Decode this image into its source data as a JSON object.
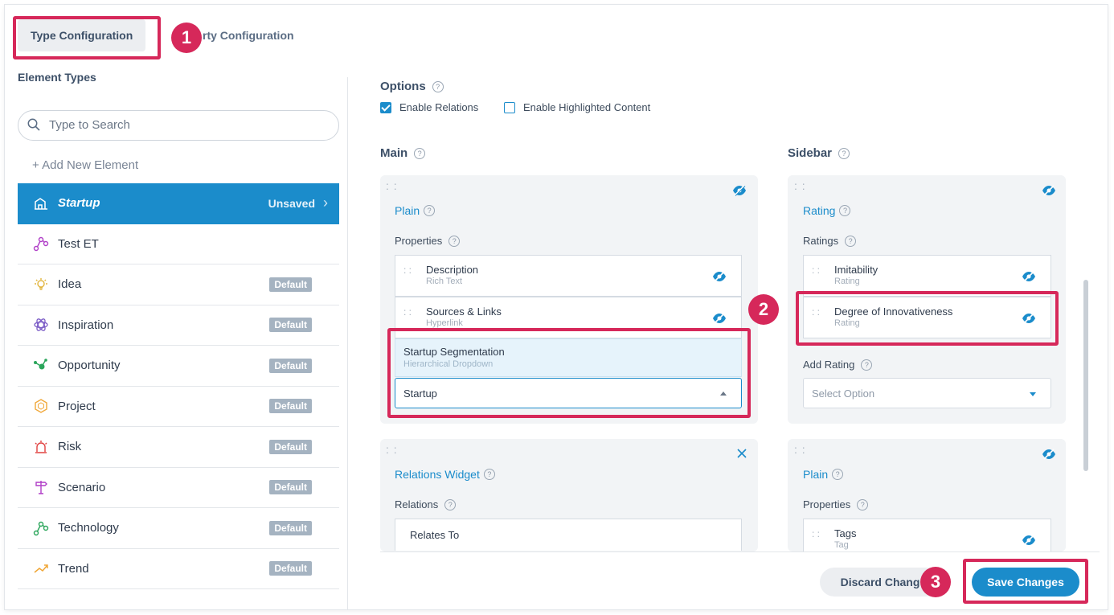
{
  "tabs": {
    "type_config": "Type Configuration",
    "property_config": "rty Configuration"
  },
  "callouts": [
    "1",
    "2",
    "3"
  ],
  "left": {
    "title": "Element Types",
    "search_placeholder": "Type to Search",
    "add_new": "+ Add New Element",
    "items": [
      {
        "label": "Startup",
        "icon": "building-icon",
        "status": "Unsaved",
        "selected": true
      },
      {
        "label": "Test ET",
        "icon": "network-icon",
        "status": ""
      },
      {
        "label": "Idea",
        "icon": "lightbulb-icon",
        "status": "Default"
      },
      {
        "label": "Inspiration",
        "icon": "atom-icon",
        "status": "Default"
      },
      {
        "label": "Opportunity",
        "icon": "opportunity-icon",
        "status": "Default"
      },
      {
        "label": "Project",
        "icon": "hexagon-icon",
        "status": "Default"
      },
      {
        "label": "Risk",
        "icon": "alarm-icon",
        "status": "Default"
      },
      {
        "label": "Scenario",
        "icon": "signpost-icon",
        "status": "Default"
      },
      {
        "label": "Technology",
        "icon": "network-icon",
        "status": "Default"
      },
      {
        "label": "Trend",
        "icon": "trend-icon",
        "status": "Default"
      }
    ]
  },
  "options": {
    "title": "Options",
    "enable_relations": "Enable Relations",
    "enable_relations_checked": true,
    "enable_highlighted": "Enable Highlighted Content",
    "enable_highlighted_checked": false
  },
  "main": {
    "title": "Main",
    "plain_widget": {
      "title": "Plain",
      "subtitle": "Properties",
      "items": [
        {
          "name": "Description",
          "type": "Rich Text"
        },
        {
          "name": "Sources & Links",
          "type": "Hyperlink"
        },
        {
          "name": "Startup Segmentation",
          "type": "Hierarchical Dropdown"
        }
      ],
      "select_value": "Startup"
    },
    "relations_widget": {
      "title": "Relations Widget",
      "subtitle": "Relations",
      "items": [
        {
          "name": "Relates To"
        }
      ]
    }
  },
  "sidebar": {
    "title": "Sidebar",
    "rating_widget": {
      "title": "Rating",
      "subtitle": "Ratings",
      "items": [
        {
          "name": "Imitability",
          "type": "Rating"
        },
        {
          "name": "Degree of Innovativeness",
          "type": "Rating"
        }
      ],
      "add_label": "Add Rating",
      "add_placeholder": "Select Option"
    },
    "plain_widget": {
      "title": "Plain",
      "subtitle": "Properties",
      "items": [
        {
          "name": "Tags",
          "type": "Tag"
        }
      ]
    }
  },
  "footer": {
    "discard": "Discard Chang",
    "save": "Save Changes"
  },
  "colors": {
    "accent": "#1b8ccb",
    "callout": "#d6285a",
    "default_pill": "#a5b3c1"
  }
}
